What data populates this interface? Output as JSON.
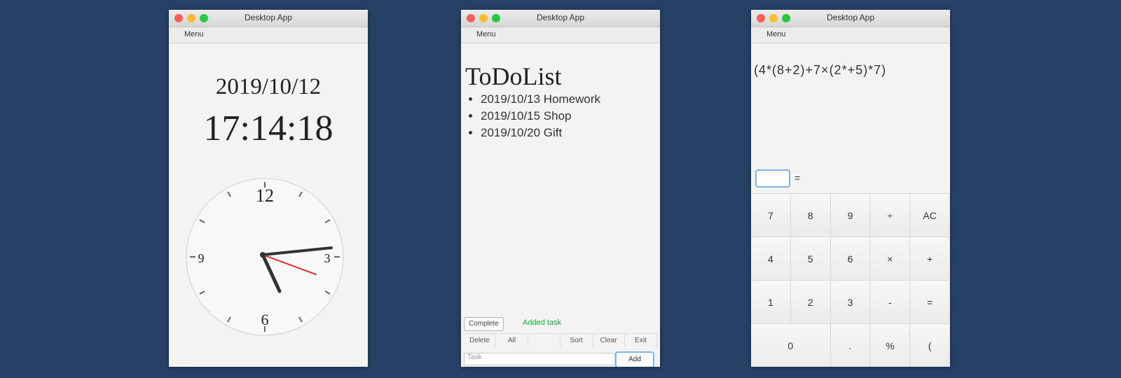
{
  "clock_window": {
    "title": "Desktop App",
    "menu": "Menu",
    "date": "2019/10/12",
    "time": "17:14:18",
    "dial_numbers": [
      "12",
      "3",
      "6",
      "9"
    ]
  },
  "todo_window": {
    "title": "Desktop App",
    "menu": "Menu",
    "heading": "ToDoList",
    "items": [
      "2019/10/13 Homework",
      "2019/10/15 Shop",
      "2019/10/20 Gift"
    ],
    "buttons": {
      "complete": "Complete",
      "status": "Added task"
    },
    "segments": [
      "Delete",
      "All",
      "",
      "Sort",
      "Clear",
      "Exit"
    ],
    "input_placeholder": "Task",
    "add_label": "Add"
  },
  "calc_window": {
    "title": "Desktop App",
    "menu": "Menu",
    "expression": "(4*(8+2)+7×(2*+5)*7)",
    "equals_label": "=",
    "keys": [
      "7",
      "8",
      "9",
      "÷",
      "AC",
      "4",
      "5",
      "6",
      "×",
      "+",
      "1",
      "2",
      "3",
      "-",
      "=",
      "0",
      ".",
      "%",
      "("
    ]
  }
}
